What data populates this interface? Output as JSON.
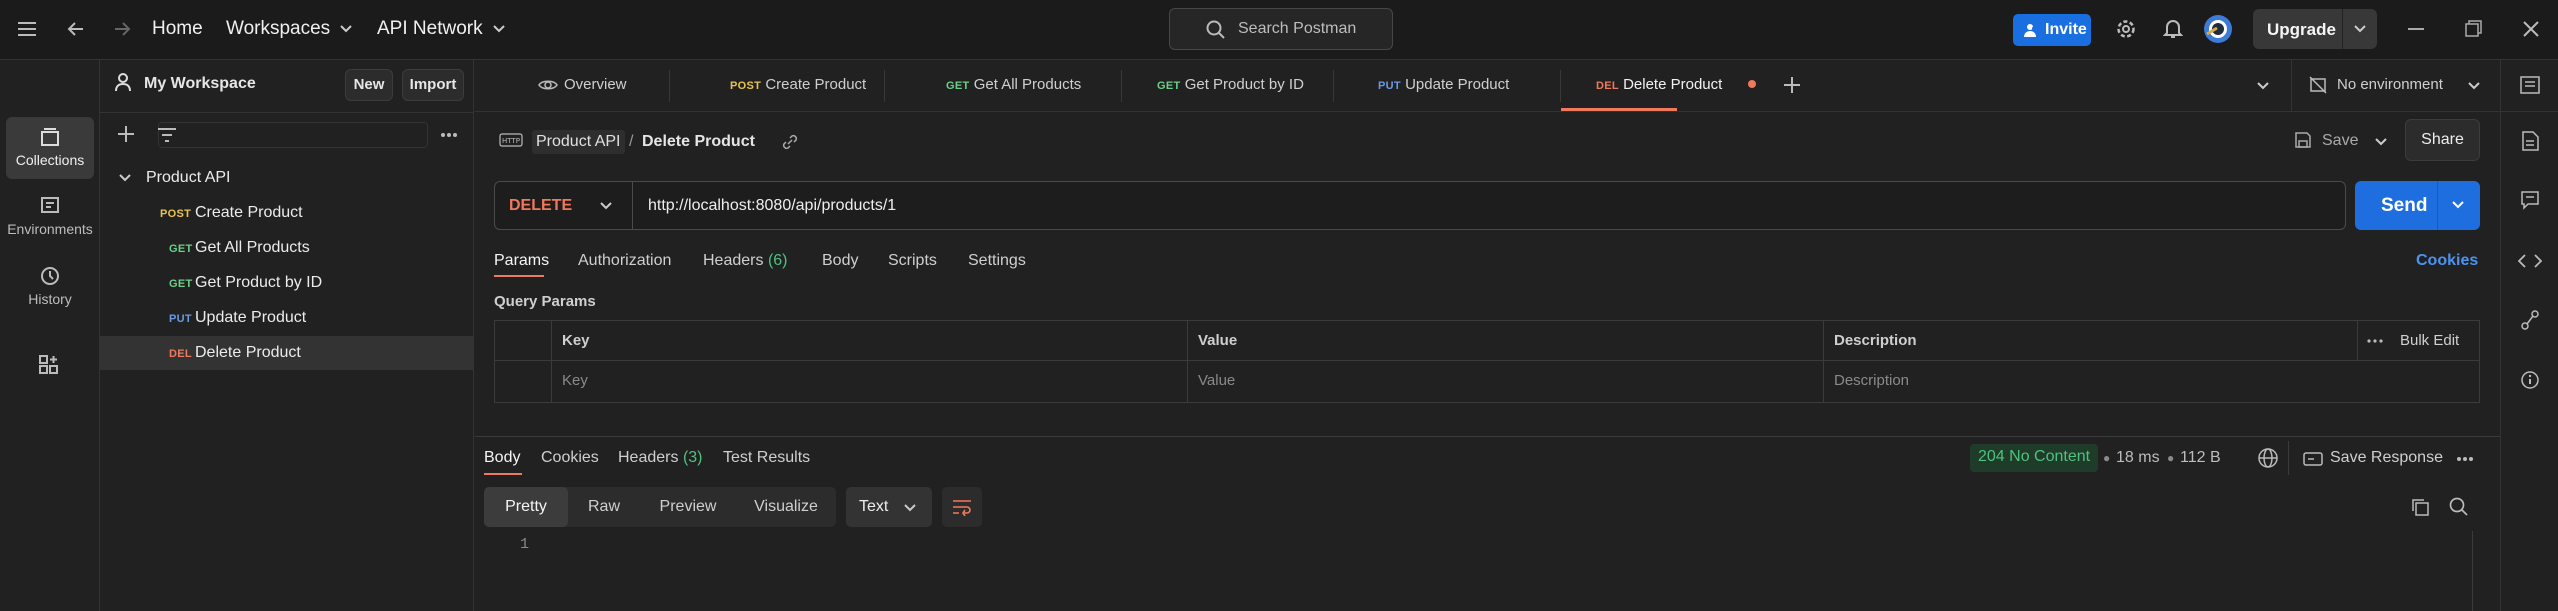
{
  "topbar": {
    "home": "Home",
    "workspaces": "Workspaces",
    "api_network": "API Network",
    "search_placeholder": "Search Postman",
    "invite": "Invite",
    "upgrade": "Upgrade"
  },
  "rail": {
    "items": [
      {
        "label": "Collections",
        "icon": "collections-icon"
      },
      {
        "label": "Environments",
        "icon": "environments-icon"
      },
      {
        "label": "History",
        "icon": "history-icon"
      }
    ]
  },
  "sidebar": {
    "workspace": "My Workspace",
    "new": "New",
    "import": "Import",
    "collection": "Product API",
    "requests": [
      {
        "method": "POST",
        "name": "Create Product"
      },
      {
        "method": "GET",
        "name": "Get All Products"
      },
      {
        "method": "GET",
        "name": "Get Product by ID"
      },
      {
        "method": "PUT",
        "name": "Update Product"
      },
      {
        "method": "DEL",
        "name": "Delete Product"
      }
    ]
  },
  "tabs": {
    "overview": "Overview",
    "items": [
      {
        "method": "POST",
        "name": "Create Product"
      },
      {
        "method": "GET",
        "name": "Get All Products"
      },
      {
        "method": "GET",
        "name": "Get Product by ID"
      },
      {
        "method": "PUT",
        "name": "Update Product"
      },
      {
        "method": "DEL",
        "name": "Delete Product"
      }
    ],
    "environment": "No environment"
  },
  "request": {
    "breadcrumb_collection": "Product API",
    "breadcrumb_sep": "/",
    "title": "Delete Product",
    "save": "Save",
    "share": "Share",
    "method": "DELETE",
    "url": "http://localhost:8080/api/products/1",
    "send": "Send",
    "subtabs": {
      "params": "Params",
      "authorization": "Authorization",
      "headers": "Headers",
      "headers_count": "(6)",
      "body": "Body",
      "scripts": "Scripts",
      "settings": "Settings",
      "cookies": "Cookies"
    },
    "query_params_title": "Query Params",
    "columns": {
      "key": "Key",
      "value": "Value",
      "description": "Description",
      "bulk_edit": "Bulk Edit"
    },
    "placeholders": {
      "key": "Key",
      "value": "Value",
      "description": "Description"
    }
  },
  "response": {
    "tabs": {
      "body": "Body",
      "cookies": "Cookies",
      "headers": "Headers",
      "headers_count": "(3)",
      "test_results": "Test Results"
    },
    "status": "204 No Content",
    "time": "18 ms",
    "size": "112 B",
    "save_response": "Save Response",
    "views": [
      "Pretty",
      "Raw",
      "Preview",
      "Visualize"
    ],
    "format": "Text",
    "line_number": "1"
  },
  "colors": {
    "post": "#e8c44d",
    "get": "#6bd089",
    "put": "#6b9ae8",
    "delete": "#f0785c",
    "accent": "#1f6ee0",
    "status_ok": "#4ec27e"
  }
}
